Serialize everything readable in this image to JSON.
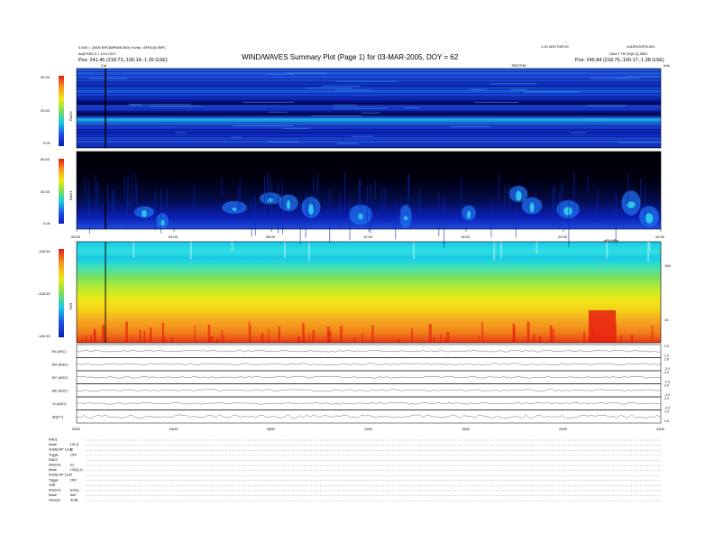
{
  "header": {
    "title": "WIND/WAVES Summary Plot (Page 1) for 03-MAR-2005, DOY = 62",
    "left_line1": "0.530 = 2(000 BPC88P086 060) Yoctty : AFNC(0) BPC",
    "left_line2": "Aé(FHS0,3 = 13.0 CEC",
    "left_line3": "Pos: 241.45 (218.73,-100.14,-1.35 GSE)",
    "right_line1": "1.10 W/O SI/FOC",
    "right_line2": "LDDR/OOFN-501",
    "right_line3": "DAILY TM 39(D,3),3601",
    "right_line4": "Pos: 245.84 (218.76,-100.17,-1.38 GSE)",
    "cal_label": "Cal",
    "top_tick_label": "TBS/THE",
    "khz_label": "kHz"
  },
  "colors": {
    "deep": "#0a1fb4",
    "mid": "#1f4fe0",
    "cyan": "#18c8e8",
    "black": "#000008",
    "green": "#7ee05a",
    "yellow": "#f0e618",
    "orange": "#f5a020",
    "red": "#e81818"
  },
  "panels": {
    "rad2": {
      "name": "RAD2",
      "ticks": [
        "40.00",
        "20.00",
        "0.00"
      ]
    },
    "rad1": {
      "name": "RAD1",
      "ticks": [
        "60.00",
        "30.00",
        "0.00"
      ]
    },
    "tnr": {
      "name": "TNR",
      "ticks": [
        "-130.00",
        "-145.00",
        "-160.00"
      ],
      "right_ticks": [
        "100",
        "10"
      ],
      "db_label": "dBV/dBn"
    },
    "time_axis": [
      "00:00",
      "04:00",
      "08:00",
      "12:00",
      "16:00",
      "20:00",
      "24:00"
    ]
  },
  "line_panels": [
    {
      "label": "BI (ASC)",
      "right": [
        "2.0",
        "1.0"
      ]
    },
    {
      "label": "BX (ASC)",
      "right": [
        "2.0",
        "-2.0"
      ]
    },
    {
      "label": "BY (ASC)",
      "right": [
        "2.0",
        "-2.0"
      ]
    },
    {
      "label": "BZ (ASC)",
      "right": [
        "2.0",
        "-2.0"
      ]
    },
    {
      "label": "Vi (ASC)",
      "right": [
        "2.0",
        "-2.0"
      ]
    },
    {
      "label": "|B|(T?)",
      "right": [
        "1.0",
        "0.3"
      ]
    }
  ],
  "bottom_time_axis": [
    "0000",
    "0400",
    "0800",
    "1200",
    "1600",
    "2000",
    "2400"
  ],
  "settings": [
    {
      "key": "RAD1",
      "value": ""
    },
    {
      "key": "Mode",
      "value": "LIS Q"
    },
    {
      "key": "SUM(CAP 1)LM",
      "value": "Q"
    },
    {
      "key": "Toggle",
      "value": "OFF"
    },
    {
      "key": "RAD2",
      "value": ""
    },
    {
      "key": "Antenna",
      "value": "Ex"
    },
    {
      "key": "Mode",
      "value": "LIS(Q,1)"
    },
    {
      "key": "SUM(CAP 1)LM",
      "value": ""
    },
    {
      "key": "Toggle",
      "value": "OFF"
    },
    {
      "key": "TNR",
      "value": ""
    },
    {
      "key": "Antenna",
      "value": "Ex/Ey"
    },
    {
      "key": "Mode",
      "value": "AéZ"
    },
    {
      "key": "Sweeps",
      "value": "ACBL"
    }
  ]
}
